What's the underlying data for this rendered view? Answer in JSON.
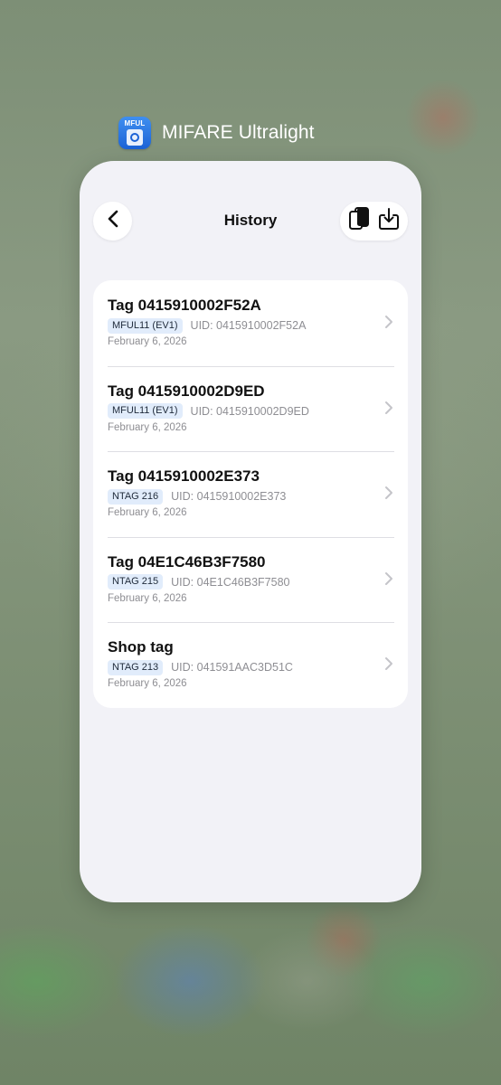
{
  "app": {
    "name": "MIFARE Ultralight",
    "icon_label": "MFUL",
    "icon_name": "mful-app-icon",
    "accent": "#2a76e6"
  },
  "nav": {
    "title": "History",
    "back_icon": "chevron-left-icon",
    "actions": [
      "copy-icon",
      "import-icon"
    ]
  },
  "history": [
    {
      "title": "Tag 0415910002F52A",
      "type": "MFUL11 (EV1)",
      "uid": "UID: 0415910002F52A",
      "date": "February 6, 2026"
    },
    {
      "title": "Tag 0415910002D9ED",
      "type": "MFUL11 (EV1)",
      "uid": "UID: 0415910002D9ED",
      "date": "February 6, 2026"
    },
    {
      "title": "Tag 0415910002E373",
      "type": "NTAG 216",
      "uid": "UID: 0415910002E373",
      "date": "February 6, 2026"
    },
    {
      "title": "Tag 04E1C46B3F7580",
      "type": "NTAG 215",
      "uid": "UID: 04E1C46B3F7580",
      "date": "February 6, 2026"
    },
    {
      "title": "Shop tag",
      "type": "NTAG 213",
      "uid": "UID: 041591AAC3D51C",
      "date": "February 6, 2026"
    }
  ]
}
